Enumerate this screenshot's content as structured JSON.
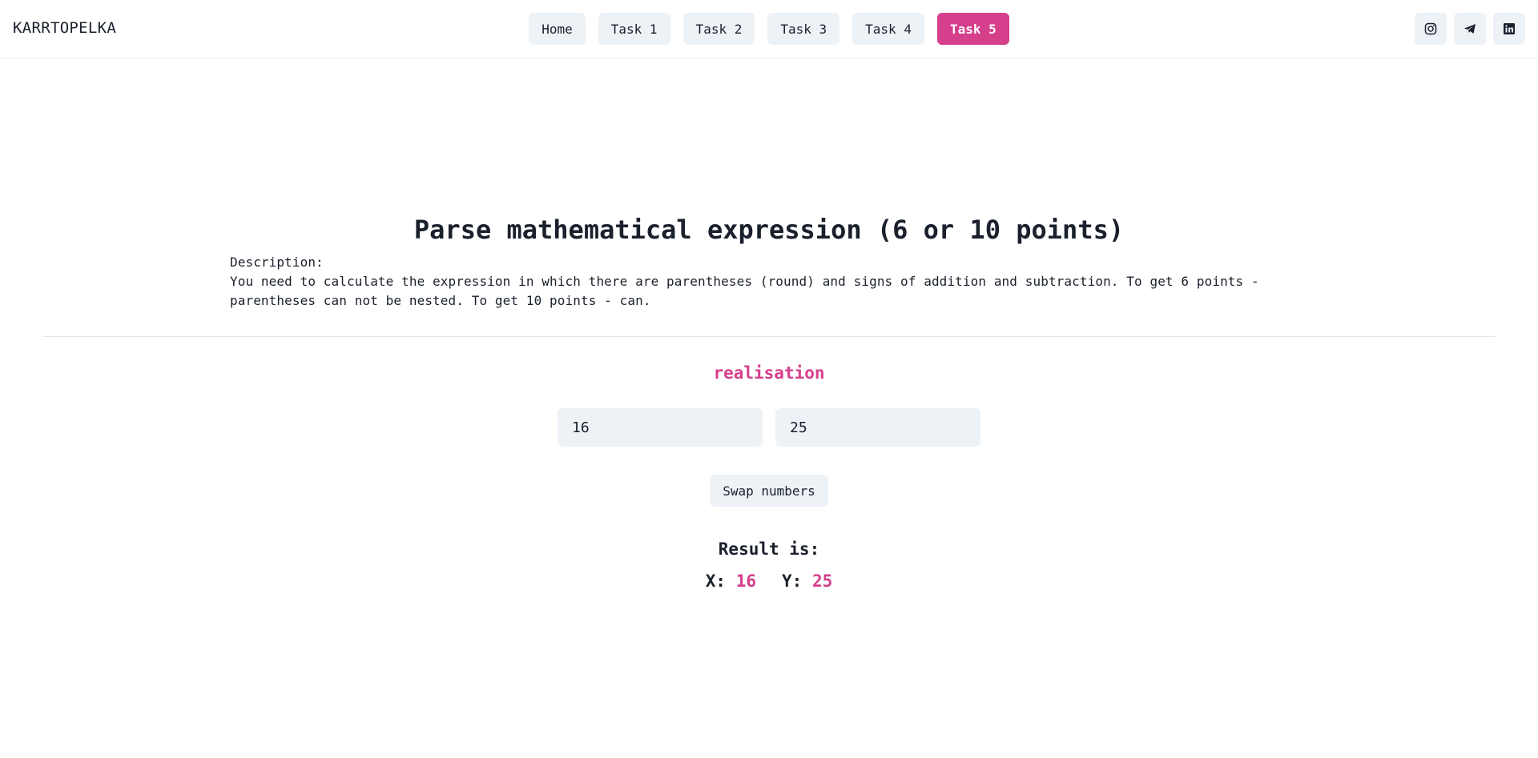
{
  "header": {
    "brand": "KARRTOPELKA",
    "nav": [
      {
        "label": "Home",
        "active": false
      },
      {
        "label": "Task 1",
        "active": false
      },
      {
        "label": "Task 2",
        "active": false
      },
      {
        "label": "Task 3",
        "active": false
      },
      {
        "label": "Task 4",
        "active": false
      },
      {
        "label": "Task 5",
        "active": true
      }
    ],
    "social": [
      "instagram-icon",
      "telegram-icon",
      "linkedin-icon"
    ]
  },
  "task": {
    "title": "Parse mathematical expression (6 or 10 points)",
    "description_label": "Description:",
    "description": "You need to calculate the expression in which there are parentheses (round) and signs of addition and subtraction. To get 6 points - parentheses can not be nested. To get 10 points - can."
  },
  "realisation": {
    "heading": "realisation",
    "input_x": "16",
    "input_y": "25",
    "swap_label": "Swap numbers",
    "result_label": "Result is:",
    "x_label": "X:",
    "x_value": "16",
    "y_label": "Y:",
    "y_value": "25"
  },
  "colors": {
    "accent": "#d53f8c",
    "button_bg": "#edf2f7",
    "text": "#1a202c"
  }
}
